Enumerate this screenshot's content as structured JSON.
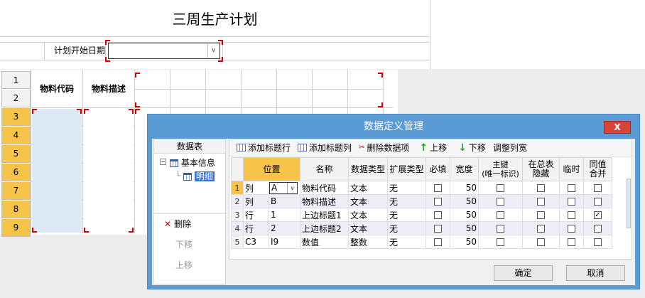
{
  "form": {
    "title": "三周生产计划",
    "start_date_label": "计划开始日期",
    "start_date_value": ""
  },
  "sheet": {
    "row_numbers": [
      "1",
      "2",
      "3",
      "4",
      "5",
      "6",
      "7",
      "8",
      "9"
    ],
    "col_headers": [
      "物料代码",
      "物料描述"
    ]
  },
  "dialog": {
    "title": "数据定义管理",
    "close_label": "X",
    "left_panel": {
      "header": "数据表",
      "tree": {
        "root": "基本信息",
        "child": "明细"
      },
      "actions": {
        "delete": "删除",
        "move_down": "下移",
        "move_up": "上移"
      }
    },
    "toolbar": {
      "add_title_row": "添加标题行",
      "add_title_col": "添加标题列",
      "delete_item": "删除数据项",
      "move_up": "上移",
      "move_down": "下移",
      "adjust_width": "调整列宽"
    },
    "table": {
      "columns": [
        "位置",
        "名称",
        "数据类型",
        "扩展类型",
        "必填",
        "宽度",
        "主键\n(唯一标识)",
        "在总表\n隐藏",
        "临时",
        "同值\n合并"
      ],
      "rows": [
        {
          "idx": "1",
          "pos_type": "列",
          "pos": "A",
          "name": "物料代码",
          "dtype": "文本",
          "ext": "无",
          "required": false,
          "width": "50",
          "pk": false,
          "hidden": false,
          "temp": false,
          "merge": false
        },
        {
          "idx": "2",
          "pos_type": "列",
          "pos": "B",
          "name": "物料描述",
          "dtype": "文本",
          "ext": "无",
          "required": false,
          "width": "50",
          "pk": false,
          "hidden": false,
          "temp": false,
          "merge": false
        },
        {
          "idx": "3",
          "pos_type": "行",
          "pos": "1",
          "name": "上边标题1",
          "dtype": "文本",
          "ext": "无",
          "required": false,
          "width": "50",
          "pk": false,
          "hidden": false,
          "temp": false,
          "merge": true
        },
        {
          "idx": "4",
          "pos_type": "行",
          "pos": "2",
          "name": "上边标题2",
          "dtype": "文本",
          "ext": "无",
          "required": false,
          "width": "50",
          "pk": false,
          "hidden": false,
          "temp": false,
          "merge": false
        },
        {
          "idx": "5",
          "pos_type": "C3",
          "pos": "I9",
          "name": "数值",
          "dtype": "整数",
          "ext": "无",
          "required": false,
          "width": "50",
          "pk": false,
          "hidden": false,
          "temp": false,
          "merge": false
        }
      ]
    },
    "buttons": {
      "ok": "确定",
      "cancel": "取消"
    }
  },
  "colors": {
    "dialog_blue": "#5b9bd5",
    "selection_orange": "#f7c44a",
    "close_red": "#d9443a",
    "highlight_red": "#d40000"
  }
}
